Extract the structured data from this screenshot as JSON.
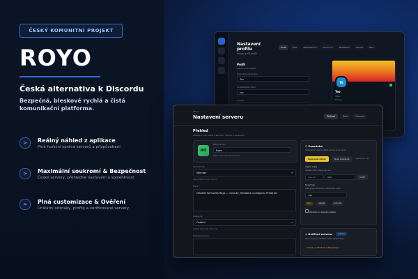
{
  "left": {
    "badge": "ČESKÝ KOMUNITNÍ PROJEKT",
    "title": "ROYO",
    "subtitle": "Česká alternativa k Discordu",
    "description": "Bezpečná, bleskově rychlá a čistá komunikační platforma.",
    "features": [
      {
        "icon": ">",
        "title": "Reálný náhled z aplikace",
        "desc": "Plně funkční správa serverů a přizpůsobení"
      },
      {
        "icon": ">",
        "title": "Maximální soukromí & Bezpečnost",
        "desc": "České servery, přehledné nastavení a spolehlivost"
      },
      {
        "icon": ">",
        "title": "Plná customizace & Ověření",
        "desc": "Unikátní odznaky, profily a verifikované servery"
      }
    ]
  },
  "back_window": {
    "title_line1": "Nastavení",
    "title_line2": "profilu",
    "subtitle": "Uprav svůj profil",
    "tabs": [
      "Profil",
      "Účet",
      "Zabezpečení",
      "Soukromí",
      "Notifikace",
      "Vzhled",
      "Hlas"
    ],
    "section": "Profil",
    "section_sub": "Jak tě uvidí ostatní",
    "fields": [
      {
        "label": "Zobrazované jméno",
        "value": "Teo"
      },
      {
        "label": "Uživatelské jméno",
        "value": "teo"
      },
      {
        "label": "O mně",
        "value": ""
      }
    ],
    "preview": {
      "avatar": "TE",
      "name": "Teo",
      "lines": [
        "@teo",
        "Online"
      ]
    }
  },
  "front_window": {
    "tag": "ROYO",
    "title": "Nastavení serveru",
    "tabs": [
      "Přehled",
      "Role",
      "Členové"
    ],
    "section": "Přehled",
    "section_sub": "Základní informace o serveru, vzhled a nastavení",
    "server": {
      "logo": "RO",
      "name_label": "Název serveru",
      "name": "Royo",
      "name_hint": "Název, který uvidí všichni členové"
    },
    "fields": {
      "default_role_label": "Výchozí role",
      "default_role": "Member",
      "default_role_hint": "Role přiřazená novým členům",
      "description_label": "Popis",
      "description": "Oficiální komunita Royo — novinky, feedback a podpora. Přidej se!",
      "category_label": "Kategorie",
      "category": "Ostatní",
      "category_hint": "Pomáhá lidem najít tvůj server",
      "rules_label": "Pravidla serveru",
      "rules": ""
    },
    "right": {
      "card1": {
        "title": "Pozvánka",
        "text": "Sdílej tento odkaz s přáteli a pozvi je na server.",
        "btn_primary": "Kopírovat odkaz",
        "btn_secondary": "Nová pozvánka",
        "expiry": "Vyprší za 7 dní",
        "vanity_label": "Vlastní odkaz",
        "vanity_hint": "Unikátní URL adresa serveru",
        "vanity_prefix": "royo.cz/",
        "vanity_value": "royo",
        "vanity_btn": "Uložit",
        "tag_label": "Server tag",
        "tag_hint": "Krátký tag zobrazený vedle jmen členů",
        "tag_value": "royo",
        "chips": [
          "Royo",
          "nejlepší",
          "komunita"
        ],
        "toggle_label": "Zobrazit ve veřejném hledání"
      },
      "card2": {
        "title": "Ověření serveru",
        "badge": "Ověřeno",
        "text": "Tento server je oficiálně ověřen týmem Royo.",
        "check": "Server je oficiálně ověřený Royo"
      }
    }
  }
}
